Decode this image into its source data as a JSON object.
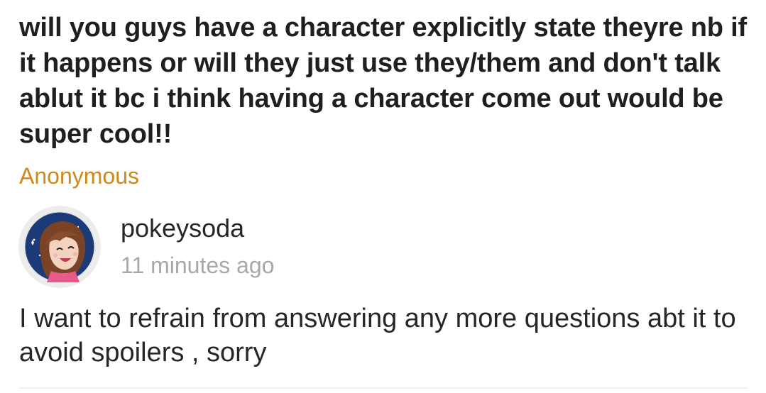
{
  "question": {
    "text": "will you guys have a character explicitly state theyre nb if it happens or will they just use they/them and don't talk ablut it bc i think having a character come out would be super cool!!",
    "asker": "Anonymous",
    "asker_color": "#cc8a1c"
  },
  "answer": {
    "username": "pokeysoda",
    "timestamp": "11 minutes ago",
    "text": "I want to refrain from answering any more questions abt it to avoid spoilers , sorry",
    "avatar_icon": "user-avatar-drawing"
  }
}
